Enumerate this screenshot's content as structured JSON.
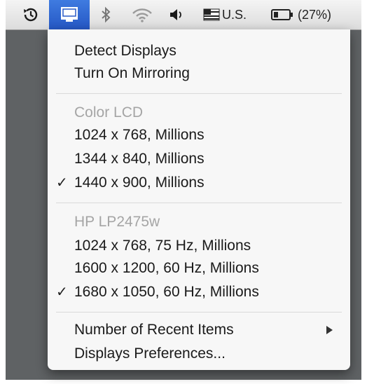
{
  "menubar": {
    "input_source": "U.S.",
    "battery": "(27%)"
  },
  "menu": {
    "actions": [
      "Detect Displays",
      "Turn On Mirroring"
    ],
    "displays": [
      {
        "name": "Color LCD",
        "modes": [
          {
            "label": "1024 x 768, Millions",
            "checked": false
          },
          {
            "label": "1344 x 840, Millions",
            "checked": false
          },
          {
            "label": "1440 x 900, Millions",
            "checked": true
          }
        ]
      },
      {
        "name": "HP LP2475w",
        "modes": [
          {
            "label": "1024 x 768, 75 Hz, Millions",
            "checked": false
          },
          {
            "label": "1600 x 1200, 60 Hz, Millions",
            "checked": false
          },
          {
            "label": "1680 x 1050, 60 Hz, Millions",
            "checked": true
          }
        ]
      }
    ],
    "check_mark": "✓",
    "recent_items": "Number of Recent Items",
    "preferences": "Displays Preferences..."
  }
}
